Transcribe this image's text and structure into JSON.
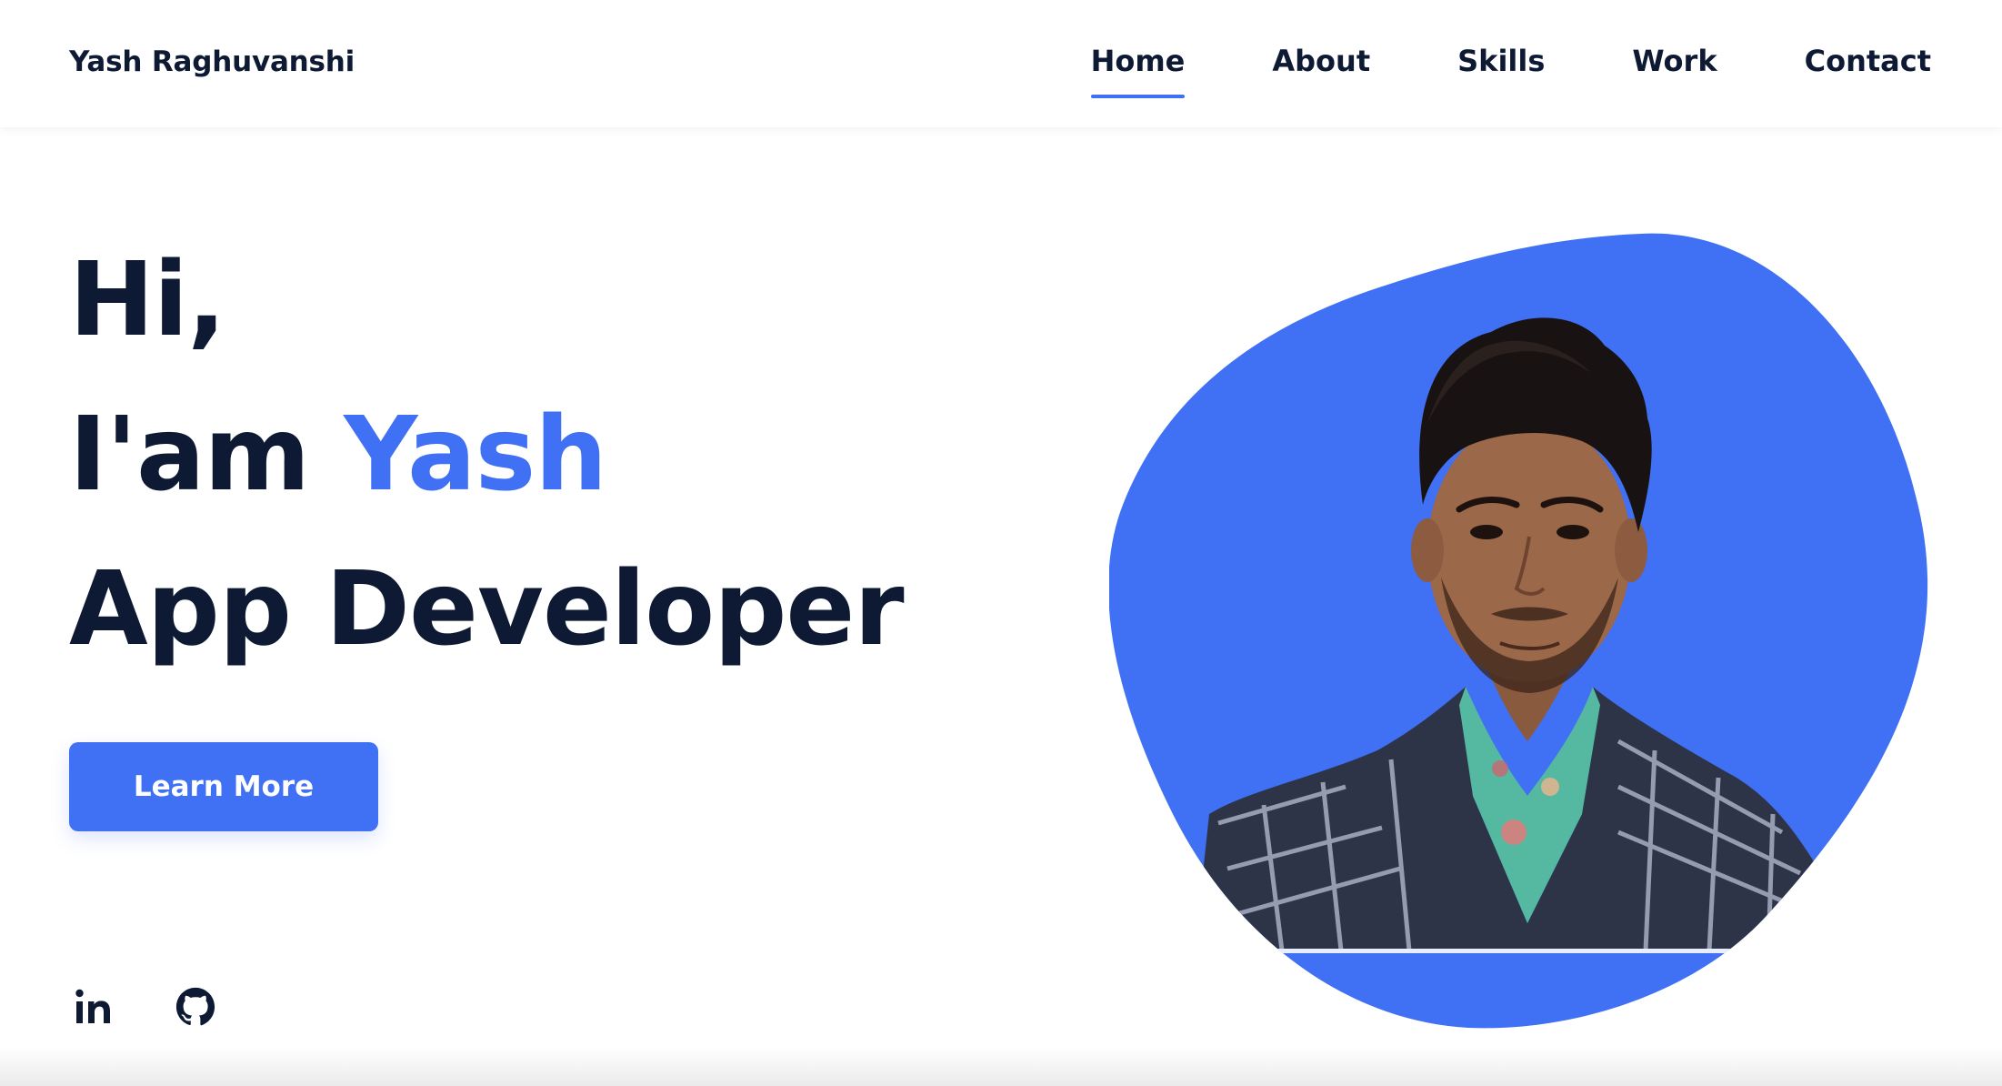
{
  "header": {
    "logo": "Yash Raghuvanshi",
    "nav": [
      {
        "label": "Home",
        "active": true
      },
      {
        "label": "About",
        "active": false
      },
      {
        "label": "Skills",
        "active": false
      },
      {
        "label": "Work",
        "active": false
      },
      {
        "label": "Contact",
        "active": false
      }
    ]
  },
  "hero": {
    "greeting": "Hi,",
    "intro_prefix": "I'am ",
    "name": "Yash",
    "role": "App Developer",
    "cta_label": "Learn More"
  },
  "socials": [
    {
      "icon": "linkedin-icon"
    },
    {
      "icon": "github-icon"
    }
  ],
  "image": {
    "type": "portrait-photo"
  },
  "colors": {
    "accent": "#4070f4",
    "text": "#0e1a33",
    "background": "#ffffff"
  }
}
